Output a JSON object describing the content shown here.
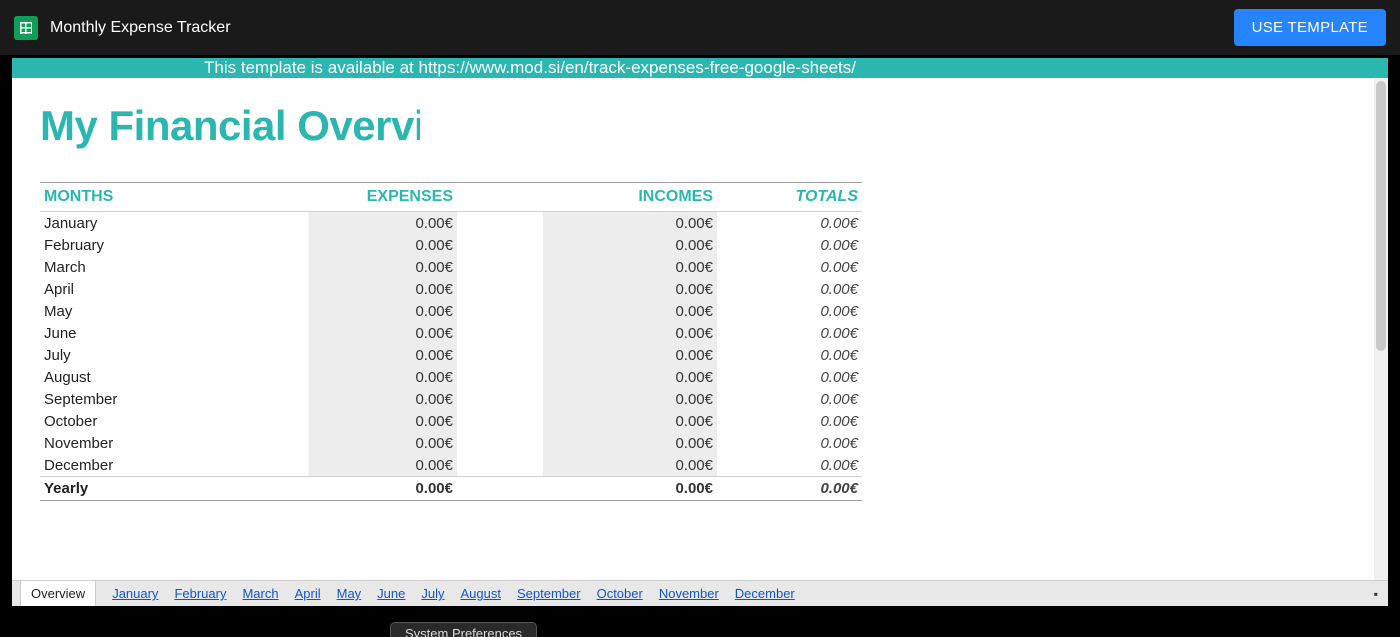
{
  "header": {
    "doc_title": "Monthly Expense Tracker",
    "use_template_label": "USE TEMPLATE"
  },
  "banner_text": "This template is available at https://www.mod.si/en/track-expenses-free-google-sheets/",
  "page_title": "My Financial Overview",
  "columns": {
    "months": "MONTHS",
    "expenses": "EXPENSES",
    "incomes": "INCOMES",
    "totals": "TOTALS"
  },
  "rows": [
    {
      "month": "January",
      "expenses": "0.00€",
      "incomes": "0.00€",
      "totals": "0.00€"
    },
    {
      "month": "February",
      "expenses": "0.00€",
      "incomes": "0.00€",
      "totals": "0.00€"
    },
    {
      "month": "March",
      "expenses": "0.00€",
      "incomes": "0.00€",
      "totals": "0.00€"
    },
    {
      "month": "April",
      "expenses": "0.00€",
      "incomes": "0.00€",
      "totals": "0.00€"
    },
    {
      "month": "May",
      "expenses": "0.00€",
      "incomes": "0.00€",
      "totals": "0.00€"
    },
    {
      "month": "June",
      "expenses": "0.00€",
      "incomes": "0.00€",
      "totals": "0.00€"
    },
    {
      "month": "July",
      "expenses": "0.00€",
      "incomes": "0.00€",
      "totals": "0.00€"
    },
    {
      "month": "August",
      "expenses": "0.00€",
      "incomes": "0.00€",
      "totals": "0.00€"
    },
    {
      "month": "September",
      "expenses": "0.00€",
      "incomes": "0.00€",
      "totals": "0.00€"
    },
    {
      "month": "October",
      "expenses": "0.00€",
      "incomes": "0.00€",
      "totals": "0.00€"
    },
    {
      "month": "November",
      "expenses": "0.00€",
      "incomes": "0.00€",
      "totals": "0.00€"
    },
    {
      "month": "December",
      "expenses": "0.00€",
      "incomes": "0.00€",
      "totals": "0.00€"
    }
  ],
  "yearly": {
    "label": "Yearly",
    "expenses": "0.00€",
    "incomes": "0.00€",
    "totals": "0.00€"
  },
  "tabs": {
    "active": "Overview",
    "others": [
      "January",
      "February",
      "March",
      "April",
      "May",
      "June",
      "July",
      "August",
      "September",
      "October",
      "November",
      "December"
    ]
  },
  "popup_label": "System Preferences"
}
